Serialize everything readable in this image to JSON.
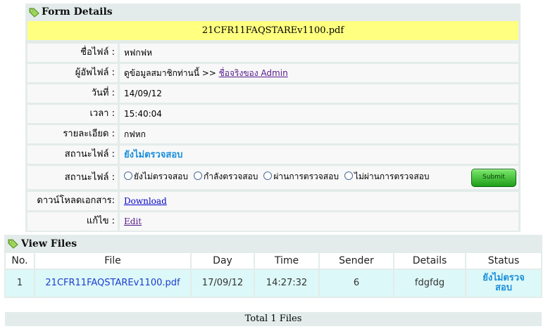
{
  "form": {
    "title": "Form Details",
    "filename": "21CFR11FAQSTAREv1100.pdf",
    "rows": {
      "file_name": {
        "label": "ชื่อไฟล์ :",
        "value": "หฟกฟห"
      },
      "uploader": {
        "label": "ผู้อัพไฟล์ :",
        "prefix": "ดูข้อมูลสมาชิกท่านนี้ >>",
        "link": "ชื่อจริงของ Admin"
      },
      "date": {
        "label": "วันที่ :",
        "value": "14/09/12"
      },
      "time": {
        "label": "เวลา :",
        "value": "15:40:04"
      },
      "details": {
        "label": "รายละเอียด :",
        "value": "กฟหก"
      },
      "status": {
        "label": "สถานะไฟล์ :",
        "value": "ยังไม่ตรวจสอบ"
      },
      "status_change": {
        "label": "สถานะไฟล์ :",
        "options": [
          "ยังไม่ตรวจสอบ",
          "กำลังตรวจสอบ",
          "ผ่านการตรวจสอบ",
          "ไม่ผ่านการตรวจสอบ"
        ],
        "submit": "Submit"
      },
      "download": {
        "label": "ดาวน์โหลดเอกสาร:",
        "link": "Download"
      },
      "edit": {
        "label": "แก้ไข :",
        "link": "Edit"
      }
    }
  },
  "view_files": {
    "title": "View Files",
    "columns": [
      "No.",
      "File",
      "Day",
      "Time",
      "Sender",
      "Details",
      "Status"
    ],
    "rows": [
      {
        "no": "1",
        "file": "21CFR11FAQSTAREv1100.pdf",
        "day": "17/09/12",
        "time": "14:27:32",
        "sender": "6",
        "details": "fdgfdg",
        "status_line1": "ยังไม่ตรวจ",
        "status_line2": "สอบ"
      }
    ],
    "total": "Total 1 Files"
  },
  "colors": {
    "panel_bg": "#e3ecea",
    "filename_bar": "#ffff80",
    "status_blue": "#1a8fdc",
    "row_bg": "#ddf8f8",
    "submit_green": "#1f9e1a"
  },
  "icons": {
    "section": "tag-icon"
  }
}
